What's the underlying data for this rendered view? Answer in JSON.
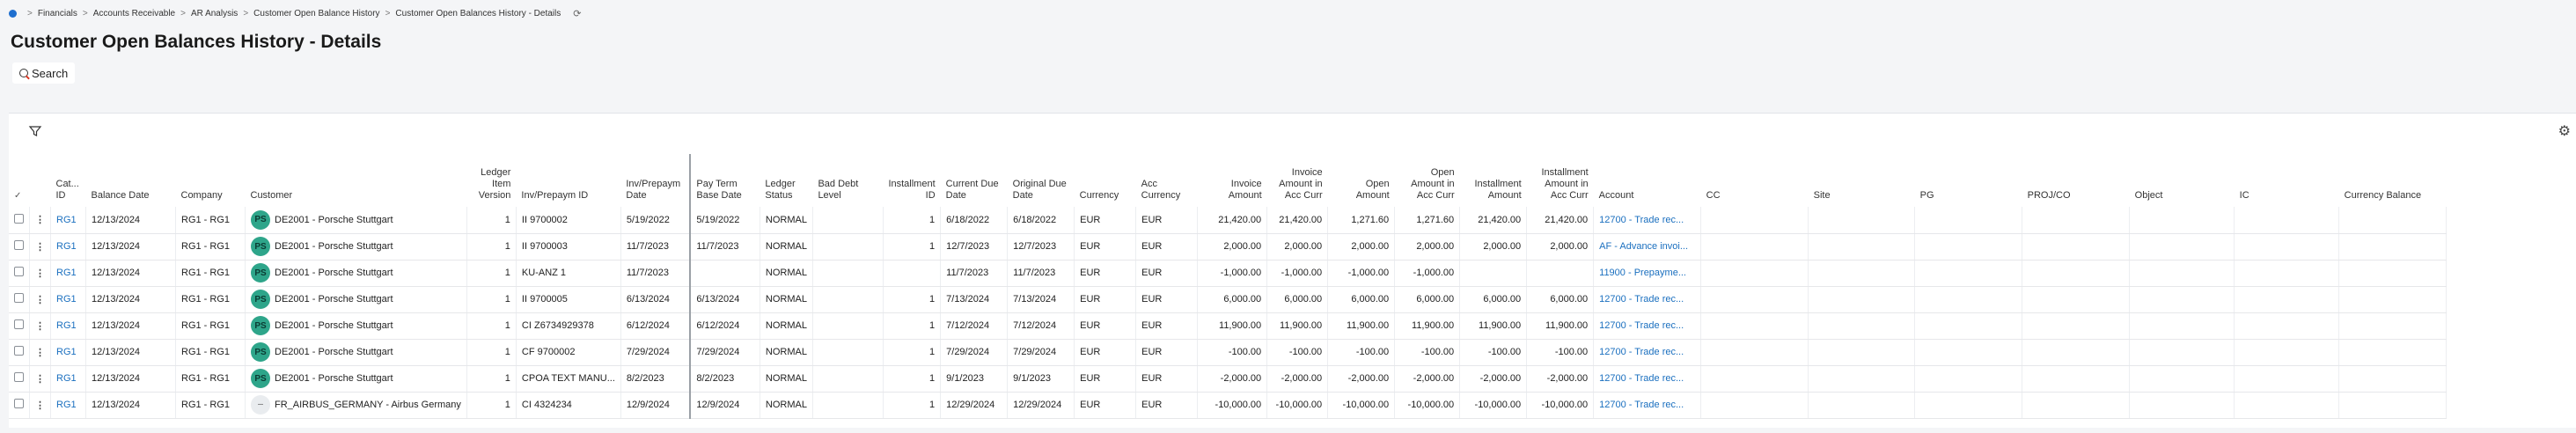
{
  "breadcrumb": {
    "items": [
      "Financials",
      "Accounts Receivable",
      "AR Analysis",
      "Customer Open Balance History",
      "Customer Open Balances History - Details"
    ],
    "separator": ">"
  },
  "page": {
    "title": "Customer Open Balances History - Details"
  },
  "toolbar": {
    "search_label": "Search"
  },
  "icons": {
    "filter": "filter-icon",
    "settings": "gear-icon",
    "refresh": "refresh-icon"
  },
  "colors": {
    "link": "#1a6fbf",
    "avatar": "#2ea58a",
    "accent": "#1f6fcf"
  },
  "table": {
    "columns": [
      {
        "key": "cat_id",
        "label": "Cat... ID"
      },
      {
        "key": "balance_date",
        "label": "Balance Date"
      },
      {
        "key": "company",
        "label": "Company"
      },
      {
        "key": "customer",
        "label": "Customer"
      },
      {
        "key": "ledger_item_version",
        "label": "Ledger Item Version"
      },
      {
        "key": "inv_id",
        "label": "Inv/Prepaym ID"
      },
      {
        "key": "inv_date",
        "label": "Inv/Prepaym Date"
      },
      {
        "key": "pay_term_base",
        "label": "Pay Term Base Date"
      },
      {
        "key": "ledger_status",
        "label": "Ledger Status"
      },
      {
        "key": "bad_debt",
        "label": "Bad Debt Level"
      },
      {
        "key": "installment_id",
        "label": "Installment ID"
      },
      {
        "key": "current_due",
        "label": "Current Due Date"
      },
      {
        "key": "original_due",
        "label": "Original Due Date"
      },
      {
        "key": "currency",
        "label": "Currency"
      },
      {
        "key": "acc_currency",
        "label": "Acc Currency"
      },
      {
        "key": "invoice_amount",
        "label": "Invoice Amount"
      },
      {
        "key": "invoice_amount_acc",
        "label": "Invoice Amount in Acc Curr"
      },
      {
        "key": "open_amount",
        "label": "Open Amount"
      },
      {
        "key": "open_amount_acc",
        "label": "Open Amount in Acc Curr"
      },
      {
        "key": "installment_amount",
        "label": "Installment Amount"
      },
      {
        "key": "installment_amount_acc",
        "label": "Installment Amount in Acc Curr"
      },
      {
        "key": "account",
        "label": "Account"
      },
      {
        "key": "cc",
        "label": "CC"
      },
      {
        "key": "site",
        "label": "Site"
      },
      {
        "key": "pg",
        "label": "PG"
      },
      {
        "key": "proj_co",
        "label": "PROJ/CO"
      },
      {
        "key": "object",
        "label": "Object"
      },
      {
        "key": "ic",
        "label": "IC"
      },
      {
        "key": "currency_balance",
        "label": "Currency Balance"
      }
    ],
    "rows": [
      {
        "cat_id": "RG1",
        "balance_date": "12/13/2024",
        "company": "RG1 - RG1",
        "avatar": "PS",
        "customer": "DE2001 - Porsche Stuttgart",
        "ledger_item_version": "1",
        "inv_id": "II 9700002",
        "inv_date": "5/19/2022",
        "pay_term_base": "5/19/2022",
        "ledger_status": "NORMAL",
        "bad_debt": "",
        "installment_id": "1",
        "current_due": "6/18/2022",
        "original_due": "6/18/2022",
        "currency": "EUR",
        "acc_currency": "EUR",
        "invoice_amount": "21,420.00",
        "invoice_amount_acc": "21,420.00",
        "open_amount": "1,271.60",
        "open_amount_acc": "1,271.60",
        "installment_amount": "21,420.00",
        "installment_amount_acc": "21,420.00",
        "account": "12700 - Trade rec...",
        "cc": "",
        "site": "",
        "pg": "",
        "proj_co": "",
        "object": "",
        "ic": "",
        "currency_balance": ""
      },
      {
        "cat_id": "RG1",
        "balance_date": "12/13/2024",
        "company": "RG1 - RG1",
        "avatar": "PS",
        "customer": "DE2001 - Porsche Stuttgart",
        "ledger_item_version": "1",
        "inv_id": "II 9700003",
        "inv_date": "11/7/2023",
        "pay_term_base": "11/7/2023",
        "ledger_status": "NORMAL",
        "bad_debt": "",
        "installment_id": "1",
        "current_due": "12/7/2023",
        "original_due": "12/7/2023",
        "currency": "EUR",
        "acc_currency": "EUR",
        "invoice_amount": "2,000.00",
        "invoice_amount_acc": "2,000.00",
        "open_amount": "2,000.00",
        "open_amount_acc": "2,000.00",
        "installment_amount": "2,000.00",
        "installment_amount_acc": "2,000.00",
        "account": "AF - Advance invoi...",
        "cc": "",
        "site": "",
        "pg": "",
        "proj_co": "",
        "object": "",
        "ic": "",
        "currency_balance": ""
      },
      {
        "cat_id": "RG1",
        "balance_date": "12/13/2024",
        "company": "RG1 - RG1",
        "avatar": "PS",
        "customer": "DE2001 - Porsche Stuttgart",
        "ledger_item_version": "1",
        "inv_id": "KU-ANZ 1",
        "inv_date": "11/7/2023",
        "pay_term_base": "",
        "ledger_status": "NORMAL",
        "bad_debt": "",
        "installment_id": "",
        "current_due": "11/7/2023",
        "original_due": "11/7/2023",
        "currency": "EUR",
        "acc_currency": "EUR",
        "invoice_amount": "-1,000.00",
        "invoice_amount_acc": "-1,000.00",
        "open_amount": "-1,000.00",
        "open_amount_acc": "-1,000.00",
        "installment_amount": "",
        "installment_amount_acc": "",
        "account": "11900 - Prepayme...",
        "cc": "",
        "site": "",
        "pg": "",
        "proj_co": "",
        "object": "",
        "ic": "",
        "currency_balance": ""
      },
      {
        "cat_id": "RG1",
        "balance_date": "12/13/2024",
        "company": "RG1 - RG1",
        "avatar": "PS",
        "customer": "DE2001 - Porsche Stuttgart",
        "ledger_item_version": "1",
        "inv_id": "II 9700005",
        "inv_date": "6/13/2024",
        "pay_term_base": "6/13/2024",
        "ledger_status": "NORMAL",
        "bad_debt": "",
        "installment_id": "1",
        "current_due": "7/13/2024",
        "original_due": "7/13/2024",
        "currency": "EUR",
        "acc_currency": "EUR",
        "invoice_amount": "6,000.00",
        "invoice_amount_acc": "6,000.00",
        "open_amount": "6,000.00",
        "open_amount_acc": "6,000.00",
        "installment_amount": "6,000.00",
        "installment_amount_acc": "6,000.00",
        "account": "12700 - Trade rec...",
        "cc": "",
        "site": "",
        "pg": "",
        "proj_co": "",
        "object": "",
        "ic": "",
        "currency_balance": ""
      },
      {
        "cat_id": "RG1",
        "balance_date": "12/13/2024",
        "company": "RG1 - RG1",
        "avatar": "PS",
        "customer": "DE2001 - Porsche Stuttgart",
        "ledger_item_version": "1",
        "inv_id": "CI Z6734929378",
        "inv_date": "6/12/2024",
        "pay_term_base": "6/12/2024",
        "ledger_status": "NORMAL",
        "bad_debt": "",
        "installment_id": "1",
        "current_due": "7/12/2024",
        "original_due": "7/12/2024",
        "currency": "EUR",
        "acc_currency": "EUR",
        "invoice_amount": "11,900.00",
        "invoice_amount_acc": "11,900.00",
        "open_amount": "11,900.00",
        "open_amount_acc": "11,900.00",
        "installment_amount": "11,900.00",
        "installment_amount_acc": "11,900.00",
        "account": "12700 - Trade rec...",
        "cc": "",
        "site": "",
        "pg": "",
        "proj_co": "",
        "object": "",
        "ic": "",
        "currency_balance": ""
      },
      {
        "cat_id": "RG1",
        "balance_date": "12/13/2024",
        "company": "RG1 - RG1",
        "avatar": "PS",
        "customer": "DE2001 - Porsche Stuttgart",
        "ledger_item_version": "1",
        "inv_id": "CF 9700002",
        "inv_date": "7/29/2024",
        "pay_term_base": "7/29/2024",
        "ledger_status": "NORMAL",
        "bad_debt": "",
        "installment_id": "1",
        "current_due": "7/29/2024",
        "original_due": "7/29/2024",
        "currency": "EUR",
        "acc_currency": "EUR",
        "invoice_amount": "-100.00",
        "invoice_amount_acc": "-100.00",
        "open_amount": "-100.00",
        "open_amount_acc": "-100.00",
        "installment_amount": "-100.00",
        "installment_amount_acc": "-100.00",
        "account": "12700 - Trade rec...",
        "cc": "",
        "site": "",
        "pg": "",
        "proj_co": "",
        "object": "",
        "ic": "",
        "currency_balance": ""
      },
      {
        "cat_id": "RG1",
        "balance_date": "12/13/2024",
        "company": "RG1 - RG1",
        "avatar": "PS",
        "customer": "DE2001 - Porsche Stuttgart",
        "ledger_item_version": "1",
        "inv_id": "CPOA TEXT MANU...",
        "inv_date": "8/2/2023",
        "pay_term_base": "8/2/2023",
        "ledger_status": "NORMAL",
        "bad_debt": "",
        "installment_id": "1",
        "current_due": "9/1/2023",
        "original_due": "9/1/2023",
        "currency": "EUR",
        "acc_currency": "EUR",
        "invoice_amount": "-2,000.00",
        "invoice_amount_acc": "-2,000.00",
        "open_amount": "-2,000.00",
        "open_amount_acc": "-2,000.00",
        "installment_amount": "-2,000.00",
        "installment_amount_acc": "-2,000.00",
        "account": "12700 - Trade rec...",
        "cc": "",
        "site": "",
        "pg": "",
        "proj_co": "",
        "object": "",
        "ic": "",
        "currency_balance": ""
      },
      {
        "cat_id": "RG1",
        "balance_date": "12/13/2024",
        "company": "RG1 - RG1",
        "avatar": "",
        "customer": "FR_AIRBUS_GERMANY - Airbus Germany",
        "ledger_item_version": "1",
        "inv_id": "CI 4324234",
        "inv_date": "12/9/2024",
        "pay_term_base": "12/9/2024",
        "ledger_status": "NORMAL",
        "bad_debt": "",
        "installment_id": "1",
        "current_due": "12/29/2024",
        "original_due": "12/29/2024",
        "currency": "EUR",
        "acc_currency": "EUR",
        "invoice_amount": "-10,000.00",
        "invoice_amount_acc": "-10,000.00",
        "open_amount": "-10,000.00",
        "open_amount_acc": "-10,000.00",
        "installment_amount": "-10,000.00",
        "installment_amount_acc": "-10,000.00",
        "account": "12700 - Trade rec...",
        "cc": "",
        "site": "",
        "pg": "",
        "proj_co": "",
        "object": "",
        "ic": "",
        "currency_balance": ""
      }
    ]
  }
}
